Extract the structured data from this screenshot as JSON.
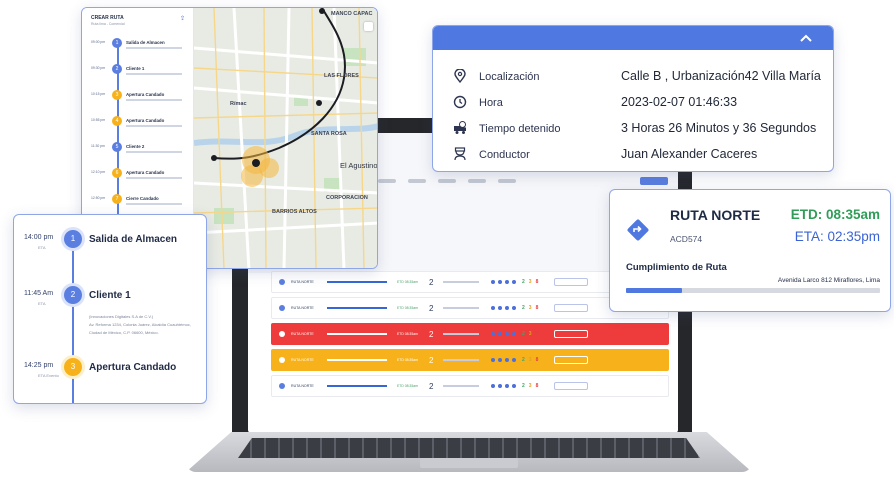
{
  "map_panel": {
    "title": "CREAR RUTA",
    "subtitle": "Ruta lima - Comercial",
    "stops": [
      {
        "time": "09:00 pm",
        "num": "1",
        "label": "Salida de Almacen",
        "color": "blue"
      },
      {
        "time": "09:30 pm",
        "num": "2",
        "label": "Cliente 1",
        "color": "blue"
      },
      {
        "time": "10:15 pm",
        "num": "3",
        "label": "Apertura Candado",
        "color": "yellow"
      },
      {
        "time": "10:55 pm",
        "num": "4",
        "label": "Apertura Candado",
        "color": "yellow"
      },
      {
        "time": "11:30 pm",
        "num": "5",
        "label": "Cliente 2",
        "color": "blue"
      },
      {
        "time": "12:10 pm",
        "num": "6",
        "label": "Apertura Candado",
        "color": "yellow"
      },
      {
        "time": "12:50 pm",
        "num": "7",
        "label": "Cierre Candado",
        "color": "yellow"
      },
      {
        "time": "13:20 pm",
        "num": "8",
        "label": "Cliente 3",
        "color": "blue"
      }
    ],
    "map_labels": {
      "manco": "MANCO CAPAC",
      "flores": "LAS FLORES",
      "rimac": "Rímac",
      "santa_rosa": "SANTA ROSA",
      "agustino": "El Agustino",
      "barrios": "BARRIOS ALTOS",
      "corporacion": "CORPORACION"
    }
  },
  "timeline": {
    "steps": [
      {
        "time": "14:00 pm",
        "sub": "ETA",
        "num": "1",
        "label": "Salida de Almacen",
        "color": "blue",
        "details": []
      },
      {
        "time": "11:45 Am",
        "sub": "ETA",
        "num": "2",
        "label": "Cliente 1",
        "color": "blue",
        "details": [
          "(Innovaciones Digitales S.A de C.V.)",
          "Av. Reforma 1234, Colonia Juárez, Alcaldía Cuauhtémoc,",
          "Ciudad de México, C.P. 06600, México."
        ]
      },
      {
        "time": "14:25 pm",
        "sub": "ETA Evento",
        "num": "3",
        "label": "Apertura Candado",
        "color": "yellow",
        "details": []
      }
    ]
  },
  "info": {
    "rows": [
      {
        "icon": "location-pin-icon",
        "key": "Localización",
        "value": "Calle B , Urbanización42 Villa María"
      },
      {
        "icon": "clock-icon",
        "key": "Hora",
        "value": "2023-02-07 01:46:33"
      },
      {
        "icon": "truck-clock-icon",
        "key": "Tiempo detenido",
        "value": "3 Horas 26 Minutos y 36 Segundos"
      },
      {
        "icon": "driver-icon",
        "key": "Conductor",
        "value": "Juan Alexander Caceres"
      }
    ]
  },
  "route": {
    "name": "RUTA NORTE",
    "code": "ACD574",
    "etd": "ETD:  08:35am",
    "eta": "ETA:  02:35pm",
    "fulfillment_label": "Cumplimiento de Ruta",
    "address": "Avenida Larco 812 Miraflores, Lima",
    "progress": 0.22
  },
  "screen_rows": [
    {
      "name": "RUTA NORTE",
      "time": "ETD 08:35am",
      "count": "2",
      "status": "white"
    },
    {
      "name": "RUTA NORTE",
      "time": "ETD 08:35am",
      "count": "2",
      "status": "white"
    },
    {
      "name": "RUTA NORTE",
      "time": "ETD 08:35am",
      "count": "2",
      "status": "red"
    },
    {
      "name": "RUTA NORTE",
      "time": "ETD 08:35am",
      "count": "2",
      "status": "yellow"
    },
    {
      "name": "RUTA NORTE",
      "time": "ETD 08:35am",
      "count": "2",
      "status": "white"
    }
  ],
  "colors": {
    "accent": "#4f79e0",
    "ok": "#2f9d57",
    "warn": "#f7b21b",
    "danger": "#ee3b3b"
  }
}
